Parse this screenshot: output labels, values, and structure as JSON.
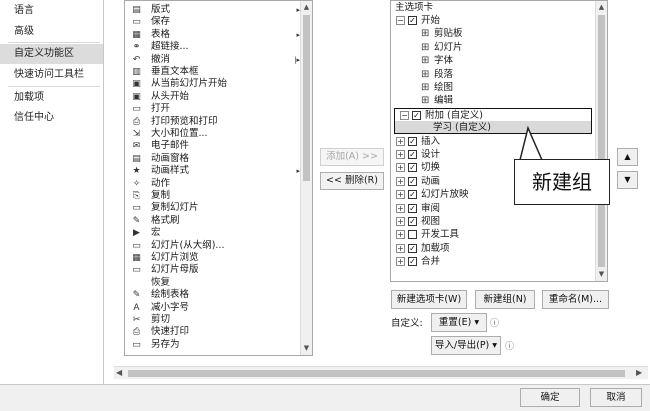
{
  "nav": {
    "items": [
      {
        "label": "语言"
      },
      {
        "label": "高级"
      },
      {
        "label": "自定义功能区"
      },
      {
        "label": "快速访问工具栏"
      },
      {
        "label": "加载项"
      },
      {
        "label": "信任中心"
      }
    ]
  },
  "commands": [
    {
      "icon": "▤",
      "label": "版式",
      "arrow": "▸"
    },
    {
      "icon": "▭",
      "label": "保存",
      "arrow": ""
    },
    {
      "icon": "▦",
      "label": "表格",
      "arrow": "▸"
    },
    {
      "icon": "⚭",
      "label": "超链接...",
      "arrow": ""
    },
    {
      "icon": "↶",
      "label": "撤消",
      "arrow": "|▸"
    },
    {
      "icon": "▥",
      "label": "垂直文本框",
      "arrow": ""
    },
    {
      "icon": "▣",
      "label": "从当前幻灯片开始",
      "arrow": ""
    },
    {
      "icon": "▣",
      "label": "从头开始",
      "arrow": ""
    },
    {
      "icon": "▭",
      "label": "打开",
      "arrow": ""
    },
    {
      "icon": "⎙",
      "label": "打印预览和打印",
      "arrow": ""
    },
    {
      "icon": "⇲",
      "label": "大小和位置...",
      "arrow": ""
    },
    {
      "icon": "✉",
      "label": "电子邮件",
      "arrow": ""
    },
    {
      "icon": "▤",
      "label": "动画窗格",
      "arrow": ""
    },
    {
      "icon": "★",
      "label": "动画样式",
      "arrow": "▸"
    },
    {
      "icon": "✧",
      "label": "动作",
      "arrow": ""
    },
    {
      "icon": "⎘",
      "label": "复制",
      "arrow": ""
    },
    {
      "icon": "▭",
      "label": "复制幻灯片",
      "arrow": ""
    },
    {
      "icon": "✎",
      "label": "格式刷",
      "arrow": ""
    },
    {
      "icon": "▶",
      "label": "宏",
      "arrow": ""
    },
    {
      "icon": "▭",
      "label": "幻灯片(从大纲)...",
      "arrow": ""
    },
    {
      "icon": "▦",
      "label": "幻灯片浏览",
      "arrow": ""
    },
    {
      "icon": "▭",
      "label": "幻灯片母版",
      "arrow": ""
    },
    {
      "icon": "",
      "label": "恢复",
      "arrow": ""
    },
    {
      "icon": "✎",
      "label": "绘制表格",
      "arrow": ""
    },
    {
      "icon": "A",
      "label": "减小字号",
      "arrow": ""
    },
    {
      "icon": "✂",
      "label": "剪切",
      "arrow": ""
    },
    {
      "icon": "⎙",
      "label": "快速打印",
      "arrow": ""
    },
    {
      "icon": "▭",
      "label": "另存为",
      "arrow": ""
    }
  ],
  "middle": {
    "add_label": "添加(A) >>",
    "remove_label": "<< 删除(R)"
  },
  "tree": {
    "header": "主选项卡",
    "rows": [
      {
        "level": 0,
        "exp": "⊟",
        "checked": true,
        "label": "开始"
      },
      {
        "level": 1,
        "exp": "⊞",
        "checked": null,
        "label": "剪贴板"
      },
      {
        "level": 1,
        "exp": "⊞",
        "checked": null,
        "label": "幻灯片"
      },
      {
        "level": 1,
        "exp": "⊞",
        "checked": null,
        "label": "字体"
      },
      {
        "level": 1,
        "exp": "⊞",
        "checked": null,
        "label": "段落"
      },
      {
        "level": 1,
        "exp": "⊞",
        "checked": null,
        "label": "绘图"
      },
      {
        "level": 1,
        "exp": "⊞",
        "checked": null,
        "label": "编辑"
      },
      {
        "level": 0,
        "exp": "⊟",
        "checked": true,
        "label": "附加 (自定义)"
      },
      {
        "level": 1,
        "exp": "",
        "checked": null,
        "label": "学习 (自定义)"
      },
      {
        "level": 0,
        "exp": "⊞",
        "checked": true,
        "label": "插入"
      },
      {
        "level": 0,
        "exp": "⊞",
        "checked": true,
        "label": "设计"
      },
      {
        "level": 0,
        "exp": "⊞",
        "checked": true,
        "label": "切换"
      },
      {
        "level": 0,
        "exp": "⊞",
        "checked": true,
        "label": "动画"
      },
      {
        "level": 0,
        "exp": "⊞",
        "checked": true,
        "label": "幻灯片放映"
      },
      {
        "level": 0,
        "exp": "⊞",
        "checked": true,
        "label": "审阅"
      },
      {
        "level": 0,
        "exp": "⊞",
        "checked": true,
        "label": "视图"
      },
      {
        "level": 0,
        "exp": "⊞",
        "checked": false,
        "label": "开发工具"
      },
      {
        "level": 0,
        "exp": "⊞",
        "checked": true,
        "label": "加载项"
      },
      {
        "level": 0,
        "exp": "⊞",
        "checked": true,
        "label": "合并"
      }
    ]
  },
  "tree_buttons": {
    "new_tab": "新建选项卡(W)",
    "new_group": "新建组(N)",
    "rename": "重命名(M)..."
  },
  "customize": {
    "label": "自定义:",
    "reset": "重置(E) ▾",
    "import_export": "导入/导出(P) ▾",
    "info": "ⓘ"
  },
  "move_buttons": {
    "up": "▲",
    "down": "▼"
  },
  "callout": {
    "text": "新建组"
  },
  "footer": {
    "ok": "确定",
    "cancel": "取消"
  }
}
